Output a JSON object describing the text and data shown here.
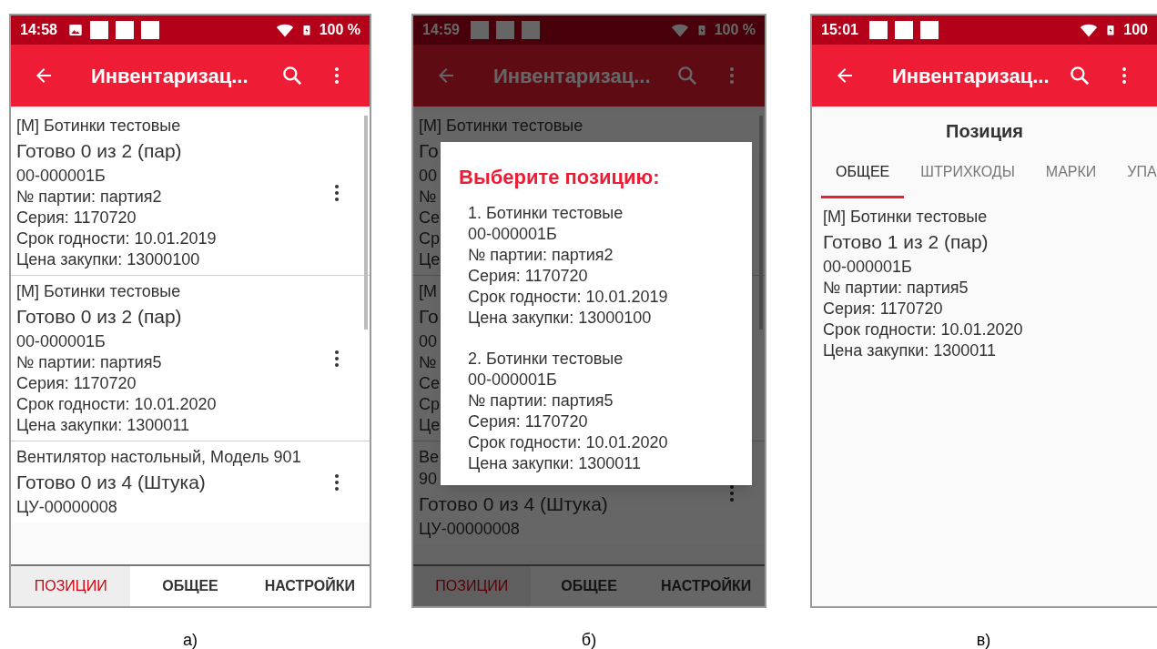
{
  "panels": [
    {
      "caption": "а)",
      "status_bar": {
        "time": "14:58",
        "icons": [
          {
            "kind": "image"
          },
          {
            "kind": "square"
          },
          {
            "kind": "square"
          },
          {
            "kind": "square"
          }
        ],
        "battery": "100 %"
      },
      "app_bar": {
        "title": "Инвентаризац..."
      },
      "content": {
        "kind": "list",
        "items": [
          {
            "menu": true,
            "lines": [
              {
                "kind": "name",
                "text": "[М] Ботинки тестовые"
              },
              {
                "kind": "progress",
                "text": "Готово 0 из 2 (пар)"
              },
              {
                "kind": "detail",
                "text": "00-000001Б"
              },
              {
                "kind": "detail",
                "text": "№ партии: партия2"
              },
              {
                "kind": "detail",
                "text": "Серия: 1170720"
              },
              {
                "kind": "detail",
                "text": "Срок годности: 10.01.2019"
              },
              {
                "kind": "detail",
                "text": "Цена закупки: 13000100"
              }
            ]
          },
          {
            "menu": true,
            "lines": [
              {
                "kind": "name",
                "text": "[М] Ботинки тестовые"
              },
              {
                "kind": "progress",
                "text": "Готово 0 из 2 (пар)"
              },
              {
                "kind": "detail",
                "text": "00-000001Б"
              },
              {
                "kind": "detail",
                "text": "№ партии: партия5"
              },
              {
                "kind": "detail",
                "text": "Серия: 1170720"
              },
              {
                "kind": "detail",
                "text": "Срок годности: 10.01.2020"
              },
              {
                "kind": "detail",
                "text": "Цена закупки: 1300011"
              }
            ]
          },
          {
            "menu": true,
            "lines": [
              {
                "kind": "name",
                "text": "Вентилятор настольный, Модель 901"
              },
              {
                "kind": "progress",
                "text": "Готово 0 из 4 (Штука)"
              },
              {
                "kind": "detail",
                "text": "ЦУ-00000008"
              }
            ]
          }
        ]
      },
      "bottom_nav": [
        {
          "label": "ПОЗИЦИИ",
          "selected": true
        },
        {
          "label": "ОБЩЕЕ",
          "selected": false
        },
        {
          "label": "НАСТРОЙКИ",
          "selected": false
        }
      ]
    },
    {
      "caption": "б)",
      "status_bar": {
        "time": "14:59",
        "icons": [
          {
            "kind": "square"
          },
          {
            "kind": "square"
          },
          {
            "kind": "square"
          }
        ],
        "battery": "100 %"
      },
      "app_bar": {
        "title": "Инвентаризац..."
      },
      "content": {
        "kind": "list_dialog",
        "items": [
          {
            "menu": false,
            "lines": [
              {
                "kind": "name",
                "text": "[М] Ботинки тестовые"
              },
              {
                "kind": "progress",
                "text": "Го"
              },
              {
                "kind": "detail",
                "text": "00"
              },
              {
                "kind": "detail",
                "text": "№"
              },
              {
                "kind": "detail",
                "text": "Се"
              },
              {
                "kind": "detail",
                "text": "Ср"
              },
              {
                "kind": "detail",
                "text": "Це"
              }
            ]
          },
          {
            "menu": false,
            "lines": [
              {
                "kind": "name",
                "text": "[М"
              },
              {
                "kind": "progress",
                "text": "Го"
              },
              {
                "kind": "detail",
                "text": "00"
              },
              {
                "kind": "detail",
                "text": "№"
              },
              {
                "kind": "detail",
                "text": "Се"
              },
              {
                "kind": "detail",
                "text": "Ср"
              },
              {
                "kind": "detail",
                "text": "Це"
              }
            ]
          },
          {
            "menu": true,
            "lines": [
              {
                "kind": "name",
                "text": "Ве"
              },
              {
                "kind": "name",
                "text": "90"
              },
              {
                "kind": "progress",
                "text": "Готово 0 из 4 (Штука)"
              },
              {
                "kind": "detail",
                "text": "ЦУ-00000008"
              }
            ]
          }
        ],
        "dialog": {
          "title": "Выберите позицию:",
          "entries": [
            [
              "1. Ботинки тестовые",
              "00-000001Б",
              "№ партии: партия2",
              "Серия: 1170720",
              "Срок годности: 10.01.2019",
              "Цена закупки: 13000100"
            ],
            [
              "2. Ботинки тестовые",
              "00-000001Б",
              "№ партии: партия5",
              "Серия: 1170720",
              "Срок годности: 10.01.2020",
              "Цена закупки: 1300011"
            ]
          ]
        }
      },
      "bottom_nav": [
        {
          "label": "ПОЗИЦИИ",
          "selected": true
        },
        {
          "label": "ОБЩЕЕ",
          "selected": false
        },
        {
          "label": "НАСТРОЙКИ",
          "selected": false
        }
      ]
    },
    {
      "caption": "в)",
      "status_bar": {
        "time": "15:01",
        "icons": [
          {
            "kind": "square"
          },
          {
            "kind": "square"
          },
          {
            "kind": "square"
          }
        ],
        "battery": "100"
      },
      "app_bar": {
        "title": "Инвентаризац..."
      },
      "content": {
        "kind": "detail",
        "heading": "Позиция",
        "tabs": [
          {
            "label": "ОБЩЕЕ",
            "selected": true
          },
          {
            "label": "ШТРИХКОДЫ",
            "selected": false
          },
          {
            "label": "МАРКИ",
            "selected": false
          },
          {
            "label": "УПА",
            "selected": false
          }
        ],
        "lines": [
          {
            "kind": "name",
            "text": "[М] Ботинки тестовые"
          },
          {
            "kind": "progress",
            "text": "Готово 1 из 2 (пар)"
          },
          {
            "kind": "detail",
            "text": "00-000001Б"
          },
          {
            "kind": "detail",
            "text": "№ партии: партия5"
          },
          {
            "kind": "detail",
            "text": "Серия: 1170720"
          },
          {
            "kind": "detail",
            "text": "Срок годности: 10.01.2020"
          },
          {
            "kind": "detail",
            "text": "Цена закупки: 1300011"
          }
        ]
      }
    }
  ]
}
